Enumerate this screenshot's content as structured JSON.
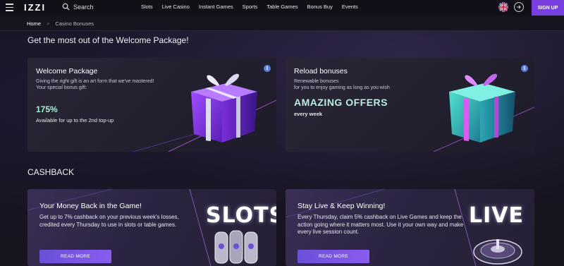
{
  "header": {
    "logo": "IZZI",
    "search_label": "Search",
    "nav": [
      "Slots",
      "Live Casino",
      "Instant Games",
      "Sports",
      "Table Games",
      "Bonus Buy",
      "Events"
    ],
    "signup_label": "SIGN UP"
  },
  "breadcrumb": {
    "home": "Home",
    "separator": ">",
    "current": "Casino Bonuses"
  },
  "welcome_section": {
    "title": "Get the most out of the Welcome Package!",
    "cards": [
      {
        "title": "Welcome Package",
        "subtitle": "Giving the right gift is an art form that we've mastered!\nYour special bonus gift:",
        "percent": "175%",
        "note": "Available for up to the 2nd top-up",
        "info": "i"
      },
      {
        "title": "Reload bonuses",
        "subtitle": "Renewable bonuses\nfor you to enjoy gaming as long as you wish",
        "headline": "AMAZING OFFERS",
        "note": "every week",
        "info": "i"
      }
    ]
  },
  "cashback_section": {
    "title": "CASHBACK",
    "cards": [
      {
        "title": "Your Money Back in the Game!",
        "text": "Get up to 7% cashback on your previous week's losses, credited every Thursday to use in slots or table games.",
        "button": "READ MORE",
        "big_word": "SLOTS"
      },
      {
        "title": "Stay Live & Keep Winning!",
        "text": "Every Thursday, claim 5% cashback on Live Games and keep the action going where it matters most. Use it your own way and make every live session count.",
        "button": "READ MORE",
        "big_word": "LIVE"
      }
    ]
  },
  "colors": {
    "accent": "#7a3fe0",
    "mint": "#a9f0d6",
    "background": "#16141f"
  }
}
